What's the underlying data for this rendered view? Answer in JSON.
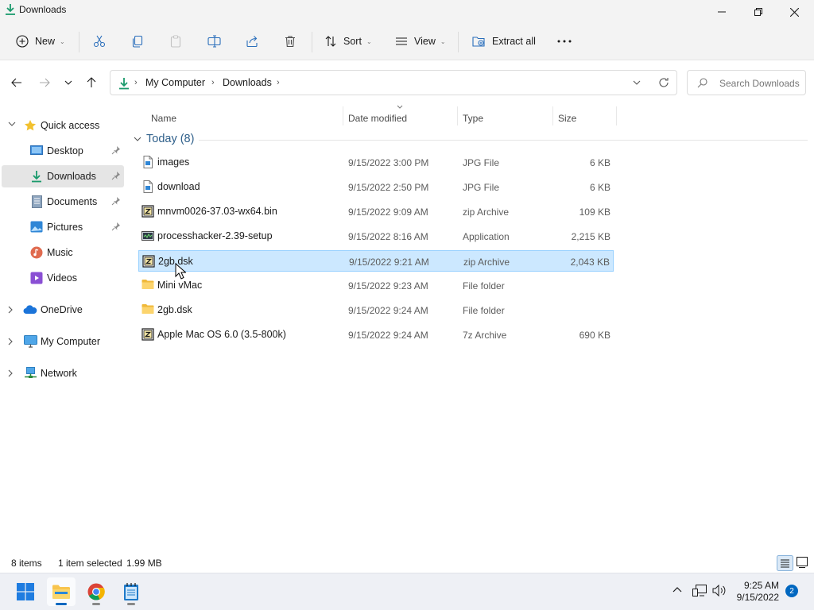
{
  "window": {
    "title": "Downloads"
  },
  "toolbar": {
    "new_label": "New",
    "sort_label": "Sort",
    "view_label": "View",
    "extract_label": "Extract all"
  },
  "address": {
    "crumbs": [
      "My Computer",
      "Downloads"
    ],
    "search_placeholder": "Search Downloads"
  },
  "sidebar": {
    "quick_access": "Quick access",
    "items": [
      {
        "label": "Desktop",
        "pinned": true
      },
      {
        "label": "Downloads",
        "pinned": true,
        "selected": true
      },
      {
        "label": "Documents",
        "pinned": true
      },
      {
        "label": "Pictures",
        "pinned": true
      },
      {
        "label": "Music",
        "pinned": false
      },
      {
        "label": "Videos",
        "pinned": false
      }
    ],
    "onedrive": "OneDrive",
    "my_computer": "My Computer",
    "network": "Network"
  },
  "columns": {
    "name": "Name",
    "date": "Date modified",
    "type": "Type",
    "size": "Size"
  },
  "group": {
    "label": "Today (8)"
  },
  "files": [
    {
      "name": "images",
      "date": "9/15/2022 3:00 PM",
      "type": "JPG File",
      "size": "6 KB",
      "icon": "image-file-icon"
    },
    {
      "name": "download",
      "date": "9/15/2022 2:50 PM",
      "type": "JPG File",
      "size": "6 KB",
      "icon": "image-file-icon"
    },
    {
      "name": "mnvm0026-37.03-wx64.bin",
      "date": "9/15/2022 9:09 AM",
      "type": "zip Archive",
      "size": "109 KB",
      "icon": "archive-file-icon"
    },
    {
      "name": "processhacker-2.39-setup",
      "date": "9/15/2022 8:16 AM",
      "type": "Application",
      "size": "2,215 KB",
      "icon": "application-icon"
    },
    {
      "name": "2gb.dsk",
      "date": "9/15/2022 9:21 AM",
      "type": "zip Archive",
      "size": "2,043 KB",
      "icon": "archive-file-icon",
      "selected": true
    },
    {
      "name": "Mini vMac",
      "date": "9/15/2022 9:23 AM",
      "type": "File folder",
      "size": "",
      "icon": "folder-icon"
    },
    {
      "name": "2gb.dsk",
      "date": "9/15/2022 9:24 AM",
      "type": "File folder",
      "size": "",
      "icon": "folder-icon"
    },
    {
      "name": "Apple Mac OS 6.0 (3.5-800k)",
      "date": "9/15/2022 9:24 AM",
      "type": "7z Archive",
      "size": "690 KB",
      "icon": "archive-file-icon"
    }
  ],
  "status": {
    "count": "8 items",
    "selected": "1 item selected",
    "size": "1.99 MB"
  },
  "taskbar": {
    "time": "9:25 AM",
    "date": "9/15/2022",
    "notifications": "2"
  },
  "colors": {
    "accent": "#0067c0",
    "selection": "#cce8ff",
    "selection_border": "#99d1ff",
    "folder": "#f8c44e"
  }
}
